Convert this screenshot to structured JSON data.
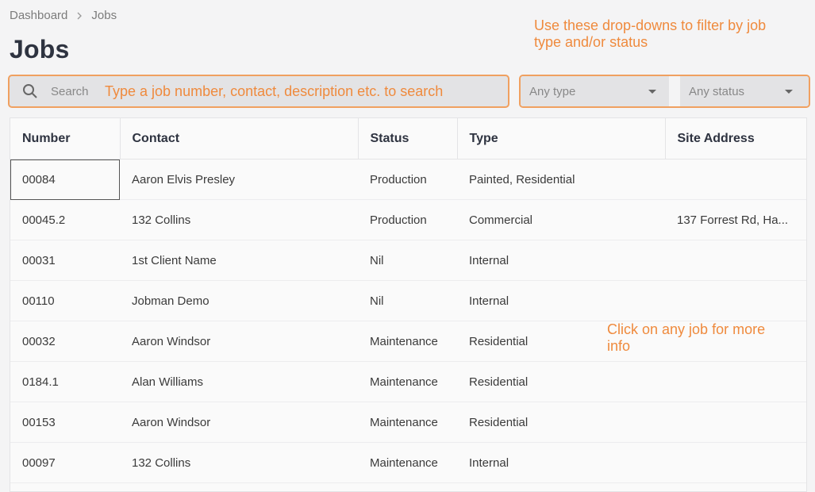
{
  "breadcrumb": {
    "items": [
      "Dashboard",
      "Jobs"
    ]
  },
  "page_title": "Jobs",
  "search": {
    "placeholder": "Search",
    "hint": "Type a job number, contact, description etc. to search"
  },
  "filters": {
    "type_value": "Any type",
    "status_value": "Any status"
  },
  "annotations": {
    "filter_hint": "Use these drop-downs to filter by job type and/or status",
    "click_hint": "Click on any job for more info"
  },
  "table": {
    "columns": [
      "Number",
      "Contact",
      "Status",
      "Type",
      "Site Address"
    ],
    "rows": [
      [
        "00084",
        "Aaron Elvis Presley",
        "Production",
        "Painted, Residential",
        ""
      ],
      [
        "00045.2",
        "132 Collins",
        "Production",
        "Commercial",
        "137 Forrest Rd, Ha..."
      ],
      [
        "00031",
        "1st Client Name",
        "Nil",
        "Internal",
        ""
      ],
      [
        "00110",
        "Jobman Demo",
        "Nil",
        "Internal",
        ""
      ],
      [
        "00032",
        "Aaron Windsor",
        "Maintenance",
        "Residential",
        ""
      ],
      [
        "0184.1",
        "Alan Williams",
        "Maintenance",
        "Residential",
        ""
      ],
      [
        "00153",
        "Aaron Windsor",
        "Maintenance",
        "Residential",
        ""
      ],
      [
        "00097",
        "132 Collins",
        "Maintenance",
        "Internal",
        ""
      ]
    ]
  },
  "colors": {
    "accent_annotation": "#ef8a3d",
    "title": "#2e3340"
  }
}
